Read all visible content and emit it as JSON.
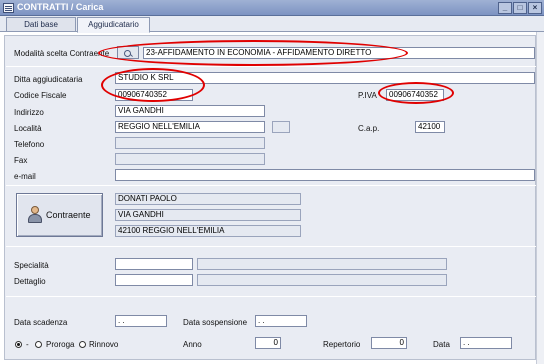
{
  "window": {
    "title": "CONTRATTI / Carica",
    "min": "_",
    "max": "□",
    "close": "×"
  },
  "tabs": [
    {
      "label": "Dati base"
    },
    {
      "label": "Aggiudicatario"
    }
  ],
  "form": {
    "modalita": {
      "label": "Modalità scelta Contraente",
      "value": "23-AFFIDAMENTO IN ECONOMIA - AFFIDAMENTO DIRETTO"
    },
    "ditta": {
      "label": "Ditta aggiudicataria",
      "value": "STUDIO K SRL"
    },
    "codice_fiscale": {
      "label": "Codice Fiscale",
      "value": "00906740352"
    },
    "piva": {
      "label": "P.IVA",
      "value": "00906740352"
    },
    "indirizzo": {
      "label": "Indirizzo",
      "value": "VIA GANDHI"
    },
    "localita": {
      "label": "Località",
      "value": "REGGIO NELL'EMILIA",
      "extra": ""
    },
    "cap": {
      "label": "C.a.p.",
      "value": "42100"
    },
    "telefono": {
      "label": "Telefono",
      "value": ""
    },
    "fax": {
      "label": "Fax",
      "value": ""
    },
    "email": {
      "label": "e-mail",
      "value": ""
    }
  },
  "contraente": {
    "button_label": "Contraente",
    "lines": [
      "DONATI PAOLO",
      "VIA GANDHI",
      "42100 REGGIO NELL'EMILIA"
    ]
  },
  "extra": {
    "specialita": {
      "label": "Specialità",
      "code": "",
      "desc": ""
    },
    "dettaglio": {
      "label": "Dettaglio",
      "code": "",
      "desc": ""
    }
  },
  "bottom": {
    "data_scadenza": {
      "label": "Data scadenza",
      "value": ". ."
    },
    "data_sospensione": {
      "label": "Data sospensione",
      "value": ". ."
    },
    "radio_dash": "-",
    "proroga": "Proroga",
    "rinnovo": "Rinnovo",
    "anno": {
      "label": "Anno",
      "value": "0"
    },
    "repertorio": {
      "label": "Repertorio",
      "value": "0"
    },
    "data": {
      "label": "Data",
      "value": ". ."
    }
  }
}
